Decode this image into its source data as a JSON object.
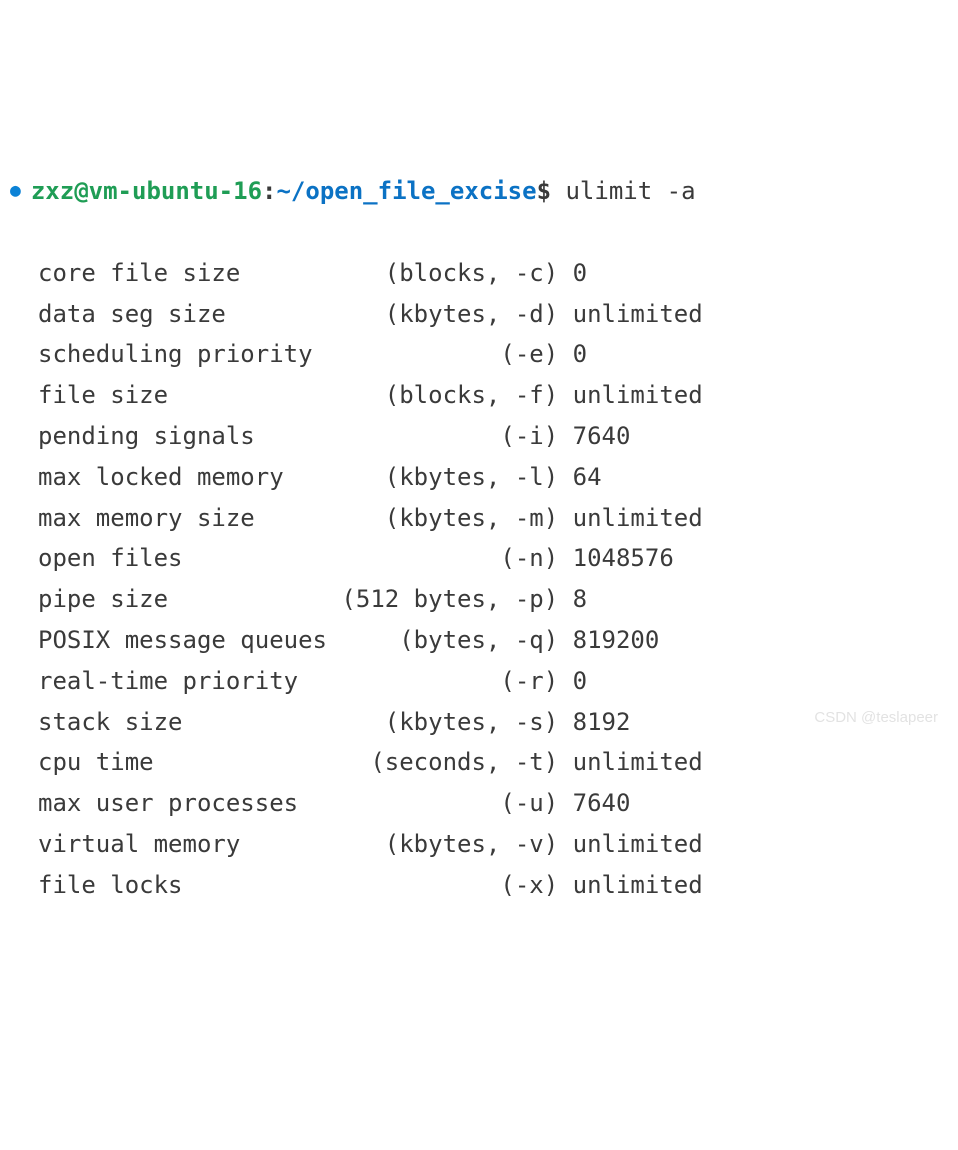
{
  "prompt": {
    "user_host": "zxz@vm-ubuntu-16",
    "separator": ":",
    "path": "~/open_file_excise",
    "symbol": "$",
    "command": "ulimit -a"
  },
  "output": [
    {
      "label": "core file size          (blocks, -c)",
      "value": "0"
    },
    {
      "label": "data seg size           (kbytes, -d)",
      "value": "unlimited"
    },
    {
      "label": "scheduling priority             (-e)",
      "value": "0"
    },
    {
      "label": "file size               (blocks, -f)",
      "value": "unlimited"
    },
    {
      "label": "pending signals                 (-i)",
      "value": "7640"
    },
    {
      "label": "max locked memory       (kbytes, -l)",
      "value": "64"
    },
    {
      "label": "max memory size         (kbytes, -m)",
      "value": "unlimited"
    },
    {
      "label": "open files                      (-n)",
      "value": "1048576"
    },
    {
      "label": "pipe size            (512 bytes, -p)",
      "value": "8"
    },
    {
      "label": "POSIX message queues     (bytes, -q)",
      "value": "819200"
    },
    {
      "label": "real-time priority              (-r)",
      "value": "0"
    },
    {
      "label": "stack size              (kbytes, -s)",
      "value": "8192"
    },
    {
      "label": "cpu time               (seconds, -t)",
      "value": "unlimited"
    },
    {
      "label": "max user processes              (-u)",
      "value": "7640"
    },
    {
      "label": "virtual memory          (kbytes, -v)",
      "value": "unlimited"
    },
    {
      "label": "file locks                      (-x)",
      "value": "unlimited"
    }
  ],
  "watermark": "CSDN @teslapeer"
}
